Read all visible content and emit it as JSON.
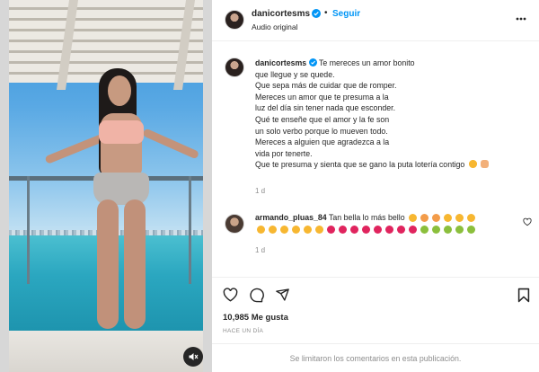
{
  "post": {
    "username": "danicortesms",
    "follow_label": "Seguir",
    "dot": "•",
    "audio_label": "Audio original",
    "caption_lines": [
      "Te mereces un amor bonito",
      "que llegue y se quede.",
      "Que sepa más de cuidar que de romper.",
      "Mereces un amor que te presuma a la",
      "luz del día sin tener nada que esconder.",
      "Qué te enseñe que el amor y la fe son",
      "un solo verbo porque lo mueven todo.",
      "Mereces a alguien que agradezca a la",
      "vida por tenerte.",
      "Que te presuma y sienta que se gano la puta lotería contigo"
    ],
    "caption_age": "1 d"
  },
  "comment": {
    "username": "armando_pluas_84",
    "text": "Tan bella lo más bello",
    "age": "1 d"
  },
  "stats": {
    "likes": "10,985 Me gusta",
    "posted": "HACE UN DÍA"
  },
  "footer": {
    "limited_comments": "Se limitaron los comentarios en esta publicación."
  },
  "icons": {
    "verified": "verified-badge-icon",
    "more": "more-options-icon",
    "like": "heart-icon",
    "comment": "comment-bubble-icon",
    "share": "paper-plane-icon",
    "save": "bookmark-icon",
    "mute": "speaker-muted-icon"
  },
  "colors": {
    "accent": "#0095f6",
    "text": "#262626",
    "muted": "#8e8e8e",
    "heart_red": "#e0245e",
    "emoji_yellow": "#f7b731"
  }
}
